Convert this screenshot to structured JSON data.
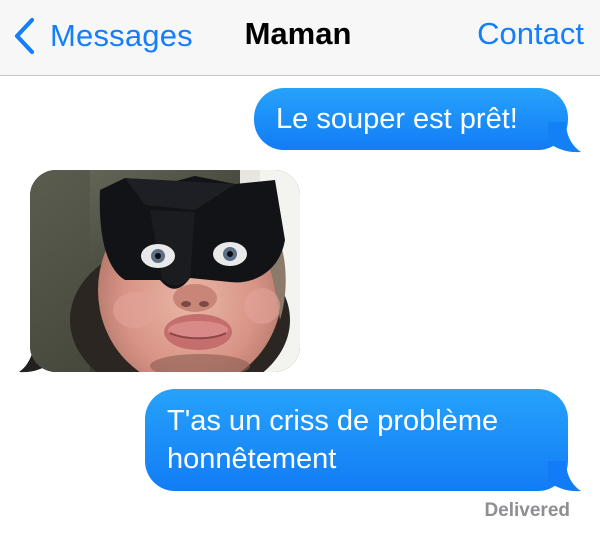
{
  "navbar": {
    "back_label": "Messages",
    "title": "Maman",
    "contact_label": "Contact"
  },
  "messages": [
    {
      "direction": "outgoing",
      "type": "text",
      "text": "Le souper est prêt!"
    },
    {
      "direction": "incoming",
      "type": "image",
      "image": "photo-person-wearing-black-mask"
    },
    {
      "direction": "outgoing",
      "type": "text",
      "lines": [
        "T'as un criss de problème",
        "honnêtement"
      ]
    }
  ],
  "status": "Delivered",
  "colors": {
    "accent": "#147efb",
    "bubble_top": "#26a2fb",
    "bubble_bottom": "#127cf6",
    "navbar_bg": "#f7f7f8",
    "status": "#8e8e93"
  },
  "icons": {
    "back": "chevron-left-icon"
  }
}
